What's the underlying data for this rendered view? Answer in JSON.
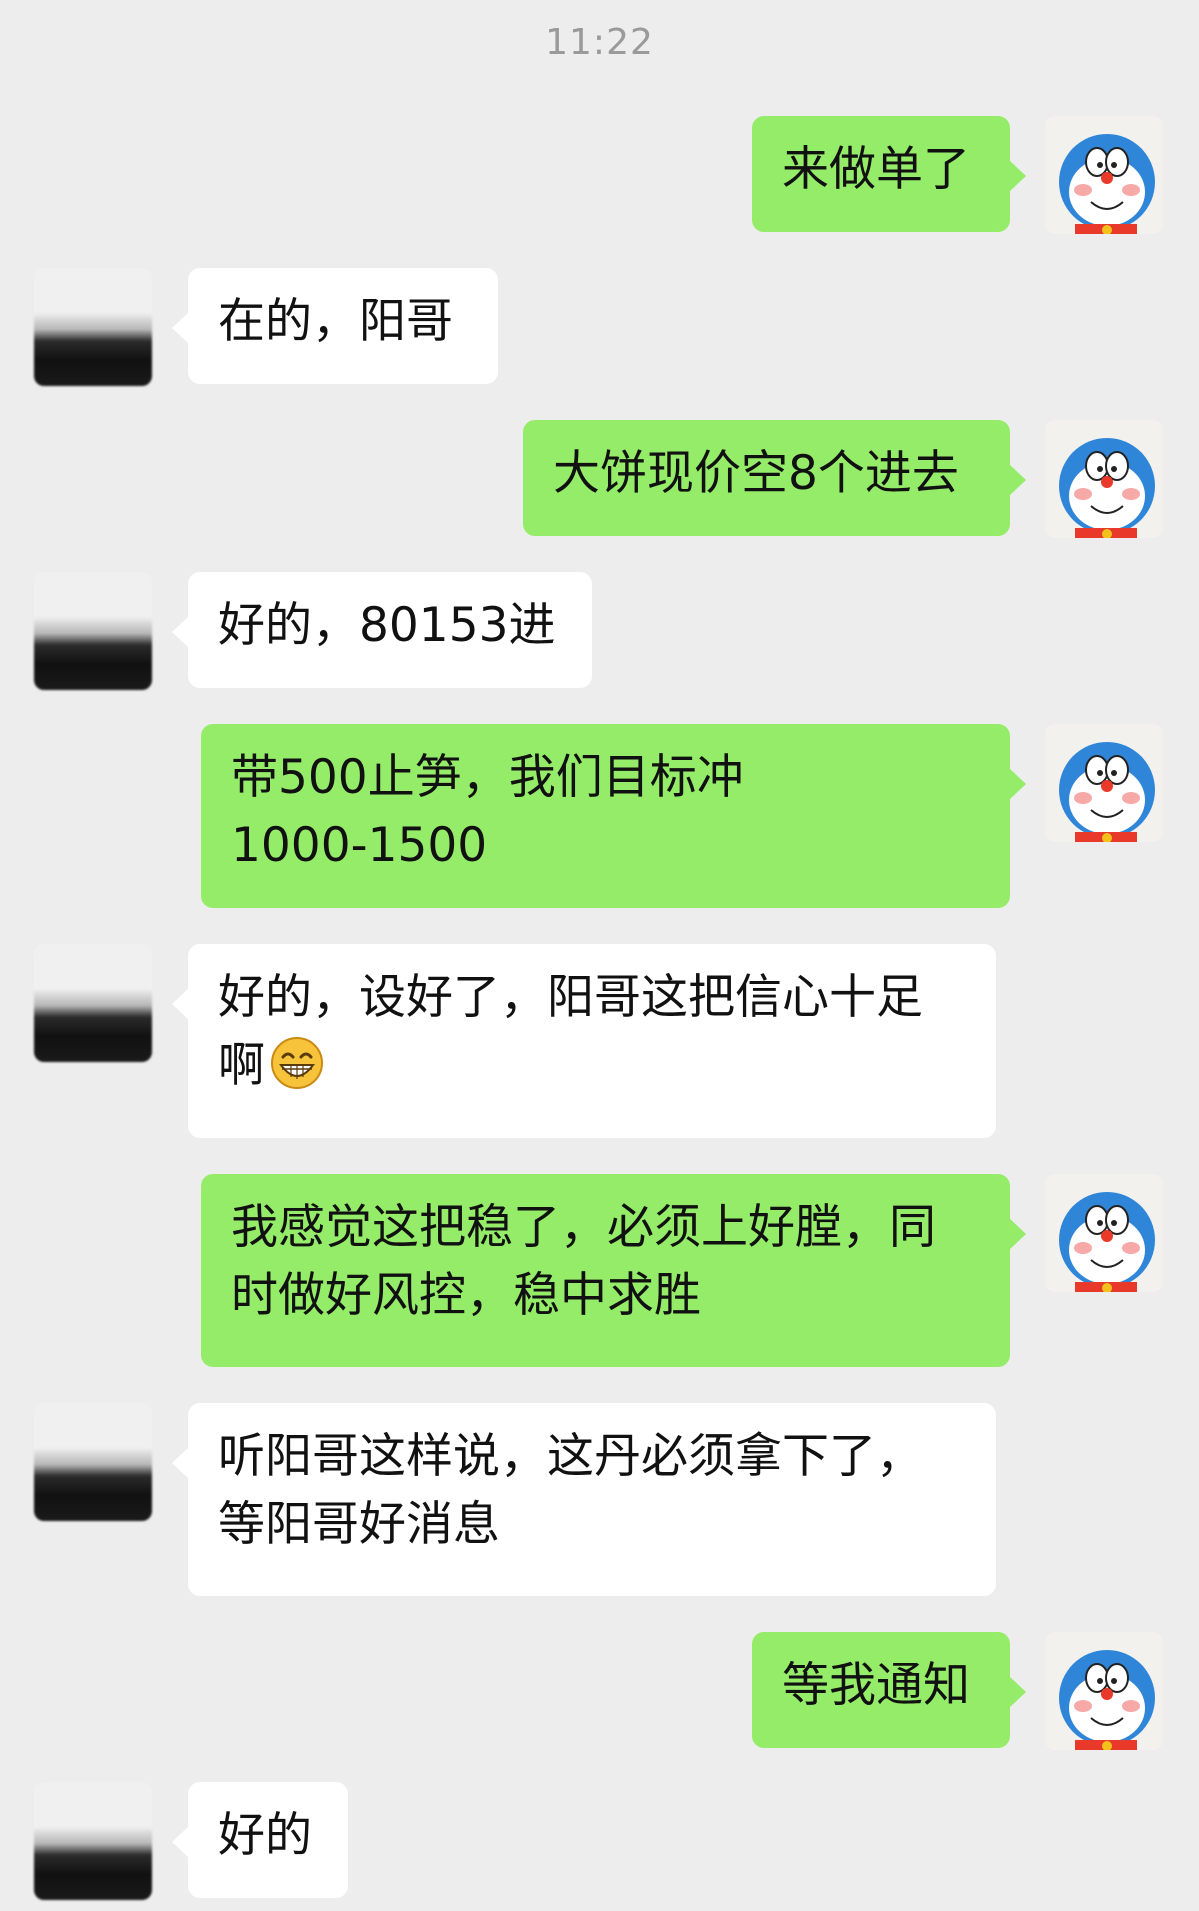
{
  "timestamp": "11:22",
  "messages": [
    {
      "sender": "me",
      "text": "来做单了"
    },
    {
      "sender": "contact",
      "text": "在的，阳哥"
    },
    {
      "sender": "me",
      "text": "大饼现价空8个进去"
    },
    {
      "sender": "contact",
      "text": "好的，80153进"
    },
    {
      "sender": "me",
      "line1": "带500止笋，我们目标冲",
      "line2": "1000-1500"
    },
    {
      "sender": "contact",
      "line1": "好的，设好了，阳哥这把信心十足",
      "line2": "啊",
      "emoji": "grin-emoji"
    },
    {
      "sender": "me",
      "line1": "我感觉这把稳了，必须上好膛，同",
      "line2": "时做好风控，稳中求胜"
    },
    {
      "sender": "contact",
      "line1": "听阳哥这样说，这丹必须拿下了，",
      "line2": "等阳哥好消息"
    },
    {
      "sender": "me",
      "text": "等我通知"
    },
    {
      "sender": "contact",
      "text": "好的"
    }
  ],
  "colors": {
    "background": "#ededed",
    "outgoing_bubble": "#95ec69",
    "incoming_bubble": "#ffffff",
    "timestamp_text": "#9a9a9a"
  },
  "icons": {
    "my_avatar": "doraemon-avatar",
    "contact_avatar": "blurred-avatar"
  }
}
